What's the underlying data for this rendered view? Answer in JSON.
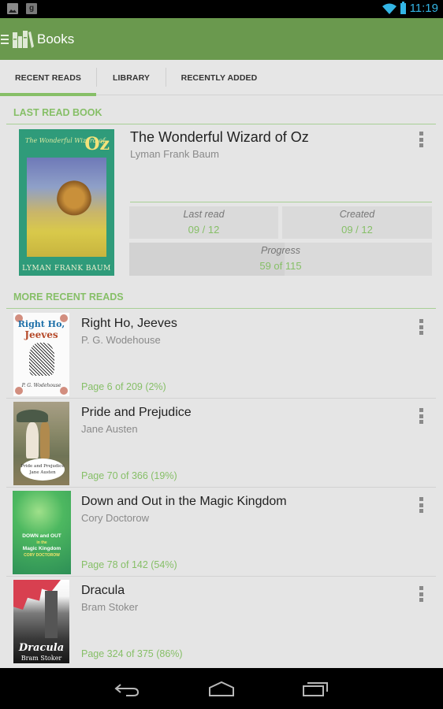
{
  "status_bar": {
    "notifications": [
      "gallery-icon",
      "google-plus-icon"
    ],
    "time": "11:19",
    "accent_color": "#33b5e5"
  },
  "action_bar": {
    "title": "Books",
    "color": "#6a994e"
  },
  "tabs": [
    {
      "label": "RECENT READS",
      "active": true
    },
    {
      "label": "LIBRARY",
      "active": false
    },
    {
      "label": "RECENTLY ADDED",
      "active": false
    }
  ],
  "last_read": {
    "section_title": "LAST READ BOOK",
    "book": {
      "title": "The Wonderful Wizard of Oz",
      "author": "Lyman Frank Baum",
      "cover": {
        "top_small": "The Wonderful Wizard of",
        "big": "Oz",
        "author": "LYMAN FRANK BAUM"
      }
    },
    "last_read_label": "Last read",
    "last_read_value": "09 / 12",
    "created_label": "Created",
    "created_value": "09 / 12",
    "progress_label": "Progress",
    "progress_value": "59 of 115",
    "progress_fraction": 0.513
  },
  "recent": {
    "section_title": "MORE RECENT READS",
    "items": [
      {
        "title": "Right Ho, Jeeves",
        "author": "P. G. Wodehouse",
        "progress": "Page 6 of 209 (2%)",
        "cover": {
          "line1": "Right Ho,",
          "line2": "Jeeves",
          "author": "P. G. Wodehouse"
        }
      },
      {
        "title": "Pride and Prejudice",
        "author": "Jane Austen",
        "progress": "Page 70 of 366 (19%)",
        "cover": {
          "line1": "Pride and Prejudice",
          "line2": "Jane Austen"
        }
      },
      {
        "title": "Down and Out in the Magic Kingdom",
        "author": "Cory Doctorow",
        "progress": "Page 78 of 142 (54%)",
        "cover": {
          "line1": "DOWN and OUT",
          "line2": "in the",
          "line3": "Magic Kingdom",
          "line4": "CORY DOCTOROW"
        }
      },
      {
        "title": "Dracula",
        "author": "Bram Stoker",
        "progress": "Page 324 of 375 (86%)",
        "cover": {
          "line1": "Dracula",
          "line2": "Bram Stoker"
        }
      }
    ]
  },
  "colors": {
    "accent_green": "#86bf67",
    "background": "#e5e5e5",
    "text_primary": "#222222",
    "text_secondary": "#8a8a8a"
  },
  "nav_bar": {
    "buttons": [
      "back-icon",
      "home-icon",
      "recent-apps-icon"
    ]
  }
}
